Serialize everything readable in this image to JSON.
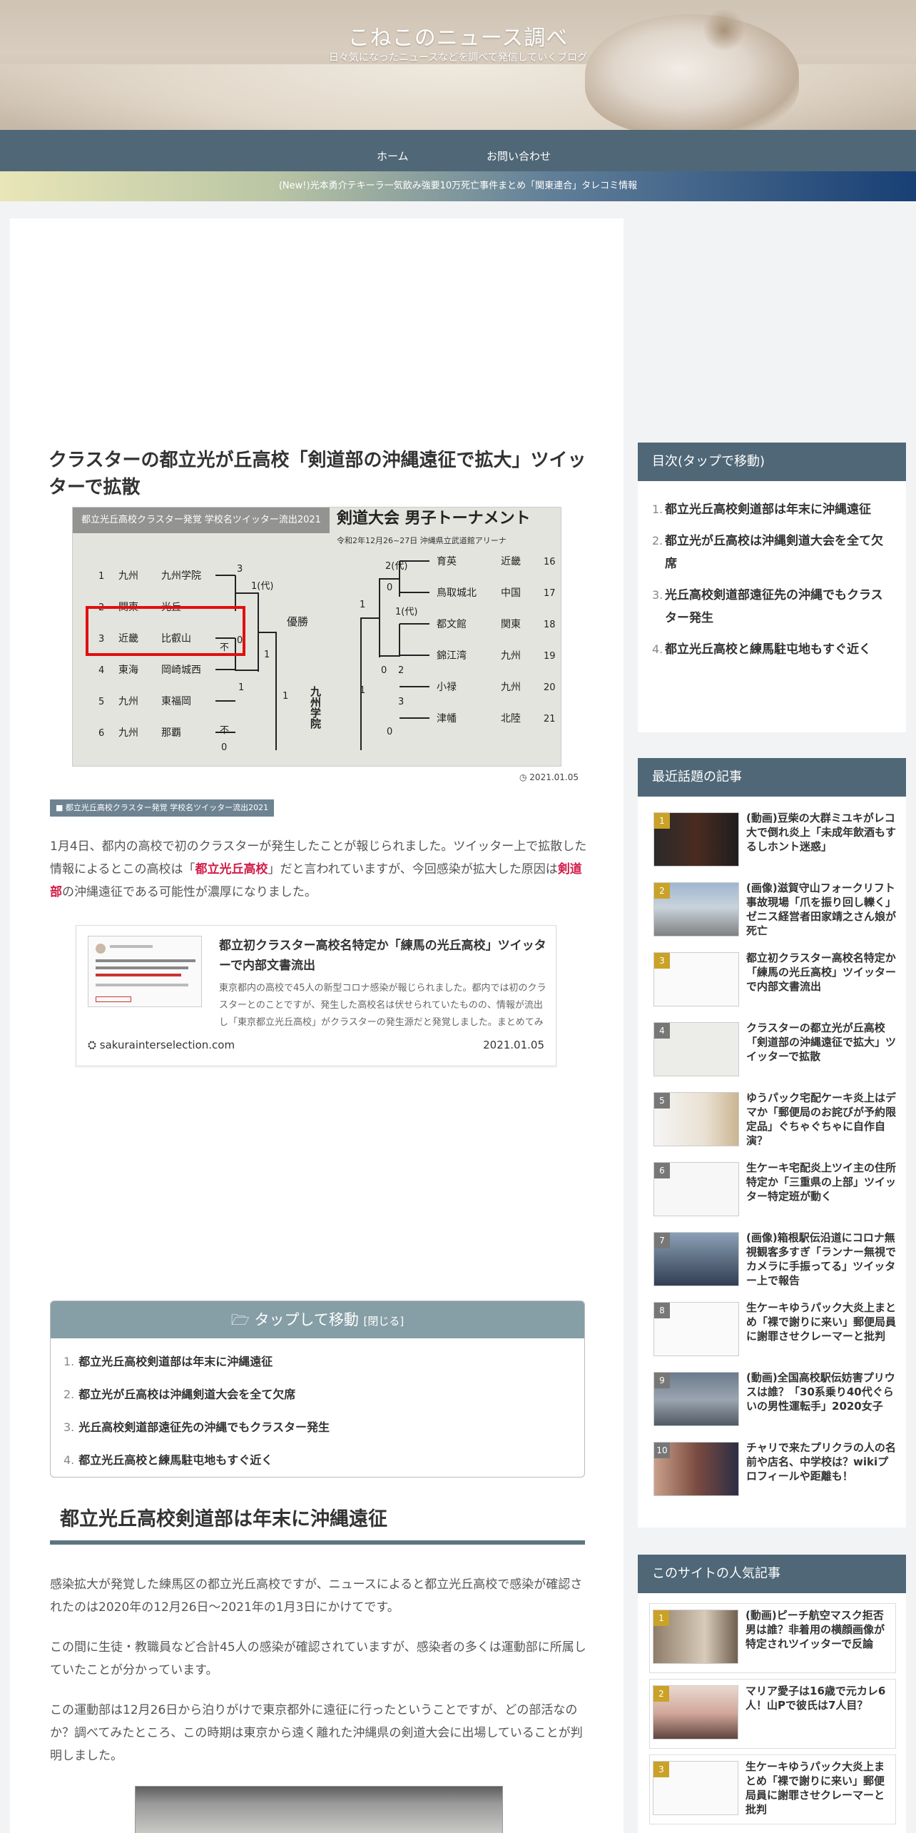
{
  "site": {
    "title": "こねこのニュース調べ",
    "description": "日々気になったニュースなどを調べて発信していくブログ"
  },
  "nav": {
    "home": "ホーム",
    "contact": "お問い合わせ"
  },
  "notice": "(New!)光本勇介テキーラ一気飲み強要10万死亡事件まとめ「関東連合」タレコミ情報",
  "article": {
    "title": "クラスターの都立光が丘高校「剣道部の沖縄遠征で拡大」ツイッターで拡散",
    "eyecatch_label": "都立光丘高校クラスター発覚 学校名ツイッター流出2021",
    "date": "2021.01.05",
    "category": "都立光丘高校クラスター発覚 学校名ツイッター流出2021",
    "intro": {
      "p1": "1月4日、都内の高校で初のクラスターが発生したことが報じられました。ツイッター上で拡散した情報によるとこの高校は「",
      "hl1": "都立光丘高校",
      "p2": "」だと言われていますが、今回感染が拡大した原因は",
      "hl2": "剣道部",
      "p3": "の沖縄遠征である可能性が濃厚になりました。"
    },
    "blogcard": {
      "title": "都立初クラスター高校名特定か「練馬の光丘高校」ツイッターで内部文書流出",
      "snippet": "東京都内の高校で45人の新型コロナ感染が報じられました。都内では初のクラスターとのことですが、発生した高校名は伏せられていたものの、情報が流出し「東京都立光丘高校」がクラスターの発生源だと発覚しました。まとめてみました。",
      "site": "sakurainterselection.com",
      "date": "2021.01.05"
    },
    "toc": {
      "title": "タップして移動",
      "close": "[閉じる]",
      "items": [
        "都立光丘高校剣道部は年末に沖縄遠征",
        "都立光が丘高校は沖縄剣道大会を全て欠席",
        "光丘高校剣道部遠征先の沖縄でもクラスター発生",
        "都立光丘高校と練馬駐屯地もすぐ近く"
      ]
    },
    "h2": "都立光丘高校剣道部は年末に沖縄遠征",
    "paras": [
      "感染拡大が発覚した練馬区の都立光丘高校ですが、ニュースによると都立光丘高校で感染が確認されたのは2020年の12月26日～2021年の1月3日にかけてです。",
      "この間に生徒・教職員など合計45人の感染が確認されていますが、感染者の多くは運動部に所属していたことが分かっています。",
      "この運動部は12月26日から泊りがけで東京都外に遠征に行ったということですが、どの部活なのか？調べてみたところ、この時期は東京から遠く離れた沖縄県の剣道大会に出場していることが判明しました。"
    ]
  },
  "sidebar": {
    "toc_title": "目次(タップで移動)",
    "toc_items": [
      "都立光丘高校剣道部は年末に沖縄遠征",
      "都立光が丘高校は沖縄剣道大会を全て欠席",
      "光丘高校剣道部遠征先の沖縄でもクラスター発生",
      "都立光丘高校と練馬駐屯地もすぐ近く"
    ],
    "recent_title": "最近話題の記事",
    "recent": [
      {
        "num": "1",
        "title": "(動画)豆柴の大群ミユキがレコ大で倒れ炎上「未成年飲酒もするしホント迷惑」"
      },
      {
        "num": "2",
        "title": "(画像)滋賀守山フォークリフト事故現場「爪を振り回し轢く」ゼニス経営者田家靖之さん娘が死亡"
      },
      {
        "num": "3",
        "title": "都立初クラスター高校名特定か「練馬の光丘高校」ツイッターで内部文書流出"
      },
      {
        "num": "4",
        "title": "クラスターの都立光が丘高校「剣道部の沖縄遠征で拡大」ツイッターで拡散"
      },
      {
        "num": "5",
        "title": "ゆうパック宅配ケーキ炎上はデマか「郵便局のお詫びが予約限定品」ぐちゃぐちゃに自作自演？"
      },
      {
        "num": "6",
        "title": "生ケーキ宅配炎上ツイ主の住所特定か「三重県の上部」ツイッター特定班が動く"
      },
      {
        "num": "7",
        "title": "(画像)箱根駅伝沿道にコロナ無視観客多すぎ「ランナー無視でカメラに手振ってる」ツイッター上で報告"
      },
      {
        "num": "8",
        "title": "生ケーキゆうパック大炎上まとめ「裸で謝りに来い」郵便局員に謝罪させクレーマーと批判"
      },
      {
        "num": "9",
        "title": "(動画)全国高校駅伝妨害プリウスは誰？「30系乗り40代ぐらいの男性運転手」2020女子"
      },
      {
        "num": "10",
        "title": "チャリで来たプリクラの人の名前や店名、中学校は？wikiプロフィールや距離も！"
      }
    ],
    "popular_title": "このサイトの人気記事",
    "popular": [
      {
        "num": "1",
        "title": "(動画)ピーチ航空マスク拒否男は誰？非着用の横顔画像が特定されツイッターで反論"
      },
      {
        "num": "2",
        "title": "マリア愛子は16歳で元カレ6人！山Pで彼氏は7人目？"
      },
      {
        "num": "3",
        "title": "生ケーキゆうパック大炎上まとめ「裸で謝りに来い」郵便局員に謝罪させクレーマーと批判"
      }
    ]
  },
  "chart_bracket": {
    "heading": "剣道大会 男子トーナメント",
    "subheading": "令和2年12月26~27日 沖縄県立武道館アリーナ",
    "left_rows": [
      {
        "n": "1",
        "region": "九州",
        "school": "九州学院"
      },
      {
        "n": "2",
        "region": "関東",
        "school": "光丘"
      },
      {
        "n": "3",
        "region": "近畿",
        "school": "比叡山"
      },
      {
        "n": "4",
        "region": "東海",
        "school": "岡崎城西"
      },
      {
        "n": "5",
        "region": "九州",
        "school": "東福岡"
      },
      {
        "n": "6",
        "region": "九州",
        "school": "那覇"
      }
    ],
    "right_rows": [
      {
        "n": "16",
        "region": "近畿",
        "school": "育英"
      },
      {
        "n": "17",
        "region": "中国",
        "school": "鳥取城北"
      },
      {
        "n": "18",
        "region": "関東",
        "school": "都文館"
      },
      {
        "n": "19",
        "region": "九州",
        "school": "錦江湾"
      },
      {
        "n": "20",
        "region": "九州",
        "school": "小禄"
      },
      {
        "n": "21",
        "region": "北陸",
        "school": "津幡"
      }
    ],
    "center": "優勝",
    "winner": "九州学院",
    "score_marks": [
      "3",
      "1(代)",
      "0",
      "1",
      "不",
      "1",
      "不",
      "0",
      "1",
      "2(代)",
      "0",
      "1",
      "1(代)",
      "2",
      "0",
      "1",
      "3",
      "0"
    ]
  },
  "colors": {
    "nav": "#4f6777",
    "highlight": "#d21c49",
    "widget_title": "#4f6777",
    "rank_badge": "#c9a227"
  }
}
